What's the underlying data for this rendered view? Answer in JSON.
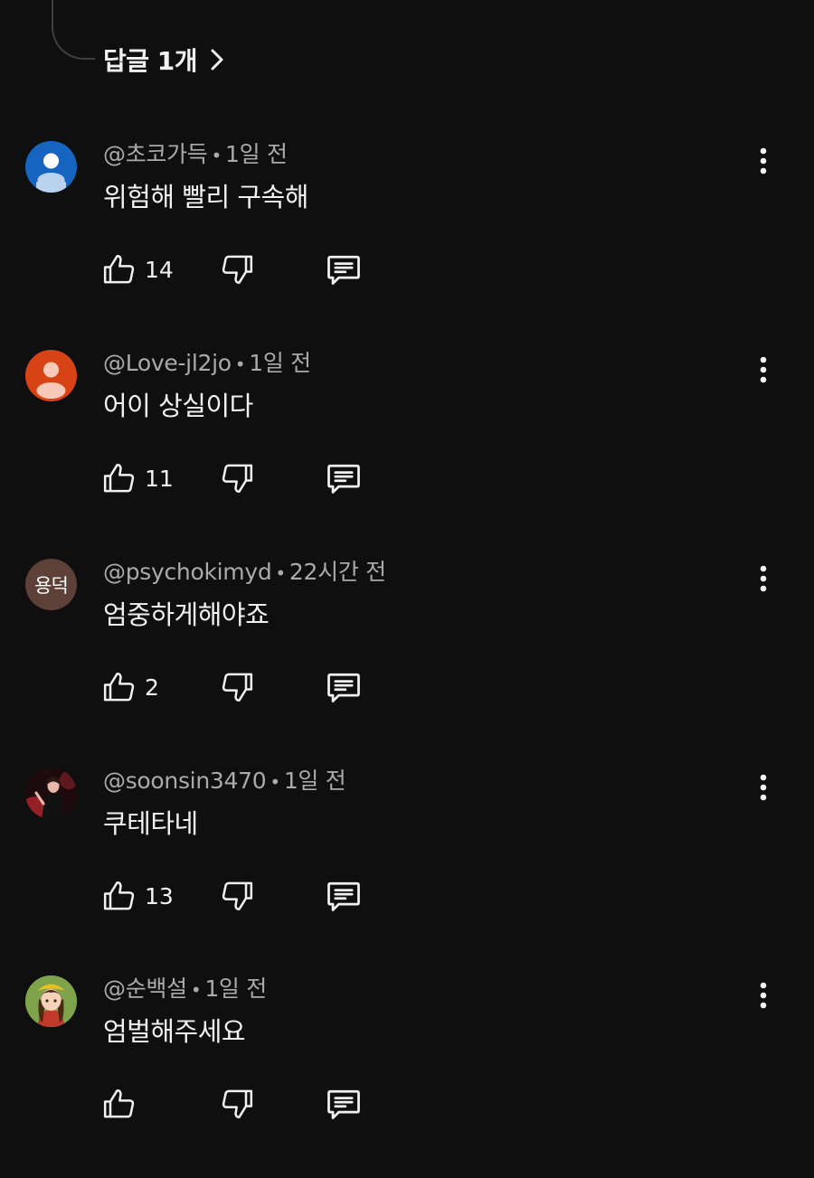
{
  "replies_link": {
    "label": "답글 1개",
    "icon": "chevron-right-icon"
  },
  "comments": [
    {
      "handle": "@초코가득",
      "time": "1일 전",
      "text": "위험해 빨리 구속해",
      "likes": "14",
      "avatar": {
        "type": "default",
        "bg": "#1565c0"
      }
    },
    {
      "handle": "@Love-jl2jo",
      "time": "1일 전",
      "text": "어이 상실이다",
      "likes": "11",
      "avatar": {
        "type": "default",
        "bg": "#d84315"
      }
    },
    {
      "handle": "@psychokimyd",
      "time": "22시간 전",
      "text": "엄중하게해야죠",
      "likes": "2",
      "avatar": {
        "type": "initials",
        "initials": "용덕",
        "bg": "#5d4037"
      }
    },
    {
      "handle": "@soonsin3470",
      "time": "1일 전",
      "text": "쿠테타네",
      "likes": "13",
      "avatar": {
        "type": "photo",
        "bg": "#3a1a1a"
      }
    },
    {
      "handle": "@순백설",
      "time": "1일 전",
      "text": "엄벌해주세요",
      "likes": "",
      "avatar": {
        "type": "photo",
        "bg": "#6b8e3d"
      }
    }
  ],
  "icons": {
    "like": "thumbs-up-icon",
    "dislike": "thumbs-down-icon",
    "reply": "reply-comment-icon",
    "more": "more-vertical-icon"
  },
  "colors": {
    "background": "#0f0f0f",
    "text_primary": "#f1f1f1",
    "text_secondary": "#aaaaaa"
  }
}
